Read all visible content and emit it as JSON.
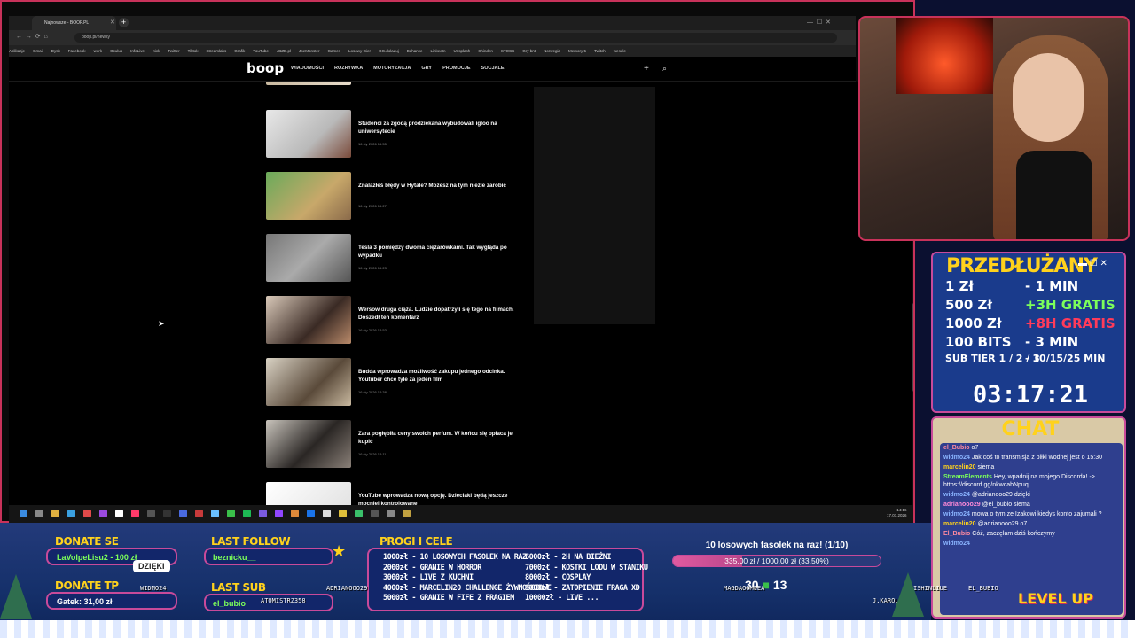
{
  "browser": {
    "tab_title": "Najnowsze - BOOP.PL",
    "url": "boop.pl/newsy",
    "bookmarks": [
      "Aplikacje",
      "Gmail",
      "Dysk",
      "Facebook",
      "work",
      "Ocułus",
      "InfoLive",
      "Kick",
      "Twitter",
      "Tiktok",
      "Streamlabs",
      "Grafik",
      "YouTube",
      "JBZD.pl",
      "JoeMonster",
      "Games",
      "Losowy Gier",
      "GG.doładuj",
      "Behance",
      "LinkedIn",
      "Unsplash",
      "Shinden",
      "STOCK",
      "Gry bnt",
      "Norwegia",
      "Memory 5",
      "Twitch",
      "wesele"
    ]
  },
  "site": {
    "logo": "boop",
    "nav": [
      "WIADOMOŚCI",
      "ROZRYWKA",
      "MOTORYZACJA",
      "GRY",
      "PROMOCJE",
      "SOCJALE"
    ]
  },
  "articles": [
    {
      "title": "Studenci za zgodą prodziekana wybudowali igloo na uniwersytecie",
      "date": "16 sty 2026 15:55"
    },
    {
      "title": "Znalazłeś błędy w Hytale? Możesz na tym nieźle zarobić",
      "date": "16 sty 2026 15:27"
    },
    {
      "title": "Tesla 3 pomiędzy dwoma ciężarówkami. Tak wygląda po wypadku",
      "date": "16 sty 2026 15:23"
    },
    {
      "title": "Wersow druga ciąża. Ludzie dopatrzyli się tego na filmach. Doszedł ten komentarz",
      "date": "16 sty 2026 14:53"
    },
    {
      "title": "Budda wprowadza możliwość zakupu jednego odcinka. Youtuber chce tyle za jeden film",
      "date": "16 sty 2026 14:38"
    },
    {
      "title": "Zara pogłębiła ceny swoich perfum. W końcu się opłaca je kupić",
      "date": "16 sty 2026 14:11"
    },
    {
      "title": "YouTube wprowadza nową opcję. Dzieciaki będą jeszcze mocniej kontrolowane",
      "date": ""
    }
  ],
  "taskbar": {
    "time": "14:16",
    "date": "17.01.2026"
  },
  "extension": {
    "title": "PRZEDŁUŻANY",
    "rows": [
      {
        "left": "1 Zł",
        "right": "- 1 MIN",
        "color": "#ffffff"
      },
      {
        "left": "500 Zł",
        "right": "+3H GRATIS",
        "color": "#7cff5a"
      },
      {
        "left": "1000 Zł",
        "right": "+8H GRATIS",
        "color": "#ff3b5a"
      },
      {
        "left": "100 BITS",
        "right": "- 3 MIN",
        "color": "#ffffff"
      },
      {
        "left": "SUB TIER 1 / 2 / 3",
        "right": "- 10/15/25 MIN",
        "color": "#ffffff"
      }
    ],
    "timer": "03:17:21"
  },
  "chat": {
    "title": "CHAT",
    "messages": [
      {
        "user": "el_Bubio",
        "text": "o7",
        "color": "#ff8aa0"
      },
      {
        "user": "widmo24",
        "text": "Jak coś to transmisja z piłki wodnej jest o 15:30",
        "color": "#8ab4ff"
      },
      {
        "user": "marcelin20",
        "text": "siema",
        "color": "#ffd21c"
      },
      {
        "user": "StreamElements",
        "text": "Hey, wpadnij na mojego Discorda! -> https://discord.gg/nkwcabNpuq",
        "color": "#7cff5a"
      },
      {
        "user": "widmo24",
        "text": "@adrianooo29 dzięki",
        "color": "#8ab4ff"
      },
      {
        "user": "adrianooo29",
        "text": "@el_bubio siema",
        "color": "#ff8ad8"
      },
      {
        "user": "widmo24",
        "text": "mowa o tym ze Izakowi kiedys konto zajumali ?",
        "color": "#8ab4ff"
      },
      {
        "user": "marcelin20",
        "text": "@adrianooo29 o7",
        "color": "#ffd21c"
      },
      {
        "user": "El_Bubio",
        "text": "Cóż, zaczęłam dziś kończymy",
        "color": "#ff8aa0"
      },
      {
        "user": "widmo24",
        "text": "",
        "color": "#8ab4ff"
      }
    ]
  },
  "overlay": {
    "donate_label": "DONATE SE",
    "donate_value": "LaVolpeLisu2 - 100 zł",
    "donate_tp_label": "DONATE TP",
    "donate_tp_value": "Gatek: 31,00 zł",
    "follow_label": "LAST FOLLOW",
    "follow_value": "beznicku__",
    "sub_label": "LAST SUB",
    "sub_value": "el_bubio",
    "goals_label": "PROGI I CELE",
    "goals_left": [
      "1000zł - 10 LOSOWYCH FASOLEK NA RAZ",
      "2000zł - GRANIE W HORROR",
      "3000zł - LIVE Z KUCHNI",
      "4000zł - MARCELIN20 CHALLENGE ŻYWNOŚCIOWE",
      "5000zł - GRANIE W FIFE Z FRAGIEM"
    ],
    "goals_right": [
      "6000zł - 2H NA BIEŻNI",
      "7000zł - KOSTKI LODU W STANIKU",
      "8000zł - COSPLAY",
      "9000zł - ZATOPIENIE FRAGA XD",
      "10000zł - LIVE ..."
    ],
    "goal_title": "10 losowych fasolek na raz! (1/10)",
    "goal_progress_text": "335,00 zł / 1000,00 zł (33.50%)",
    "goal_progress": 0.335,
    "thanks": "DZIĘKI",
    "names": [
      "WIDMO24",
      "ATOMISTRZ358",
      "ADRIANOOO29",
      "MAGDAOOMIEA",
      "ISHINLIUE",
      "EL_BUBIO",
      "J.KAROL"
    ],
    "counter_a": "30",
    "counter_b": "13",
    "levelup": "LEVEL UP"
  }
}
